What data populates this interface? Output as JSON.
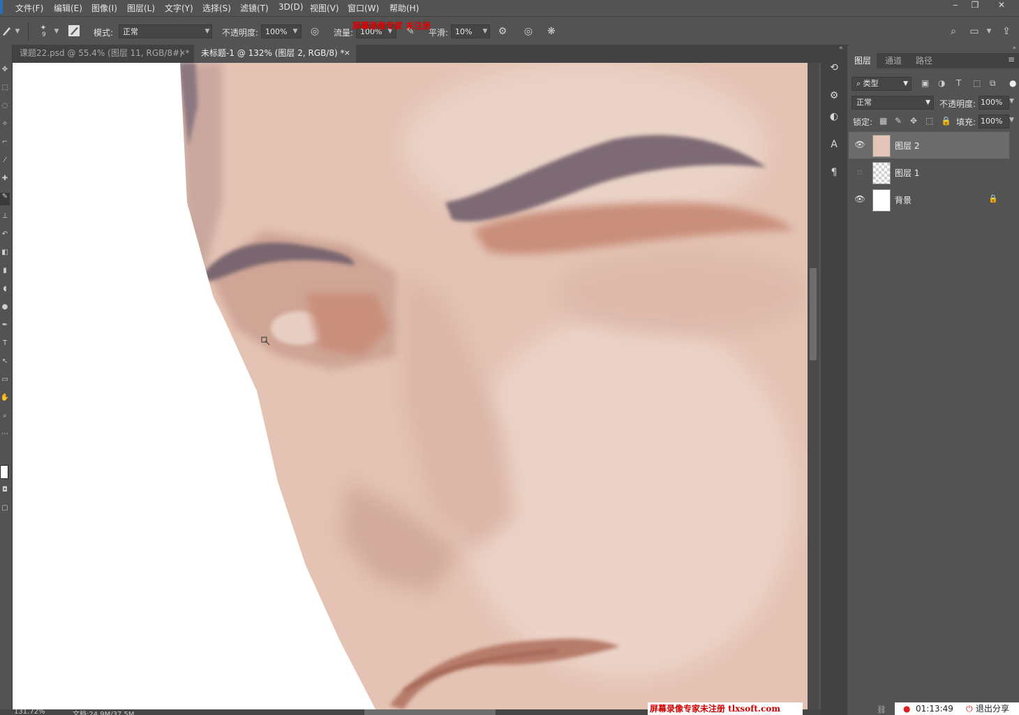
{
  "menu": [
    "文件(F)",
    "编辑(E)",
    "图像(I)",
    "图层(L)",
    "文字(Y)",
    "选择(S)",
    "滤镜(T)",
    "3D(D)",
    "视图(V)",
    "窗口(W)",
    "帮助(H)"
  ],
  "window_controls": {
    "minimize": "‒",
    "restore": "❐",
    "close": "✕"
  },
  "options": {
    "brush_size": "9",
    "mode_label": "模式:",
    "mode_value": "正常",
    "opacity_label": "不透明度:",
    "opacity_value": "100%",
    "flow_label": "流量:",
    "flow_value": "100%",
    "smooth_label": "平滑:",
    "smooth_value": "10%"
  },
  "top_watermark": "屏幕录像专家 未注册",
  "tabs": [
    {
      "label": "课题22.psd @ 55.4% (图层 11, RGB/8#) *",
      "close": "×",
      "active": false
    },
    {
      "label": "未标题-1 @ 132% (图层 2, RGB/8) *",
      "close": "×",
      "active": true
    }
  ],
  "status": {
    "zoom": "131.72%",
    "doc": "文档:24.9M/37.5M"
  },
  "watermark": "屏幕录像专家未注册 tlxsoft.com",
  "layers_panel": {
    "tabs": [
      "图层",
      "通道",
      "路径"
    ],
    "filter_kind": "类型",
    "blend_mode": "正常",
    "opacity_label": "不透明度:",
    "opacity_value": "100%",
    "lock_label": "锁定:",
    "fill_label": "填充:",
    "fill_value": "100%",
    "layers": [
      {
        "name": "图层 2",
        "visible": true,
        "selected": true
      },
      {
        "name": "图层 1",
        "visible": false,
        "selected": false
      },
      {
        "name": "背景",
        "visible": true,
        "selected": false,
        "locked": true
      }
    ]
  },
  "recording": {
    "time": "01:13:49",
    "exit": "退出分享"
  },
  "colors": {
    "ui_bg": "#535353",
    "skin": "#e6c6b6",
    "brow": "#7a6670",
    "accent_red": "#d00000"
  }
}
